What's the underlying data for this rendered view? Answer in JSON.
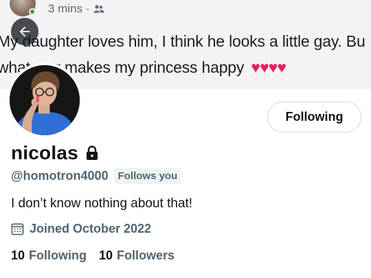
{
  "banner": {
    "post_time": "3 mins",
    "post_separator": "·",
    "audience_icon": "friends-icon",
    "post_line_1": "My daughter loves him, I think he looks a little gay. Bu",
    "post_line_2": "whatever makes my princess happy",
    "hearts": "♥♥♥♥"
  },
  "nav": {
    "back_icon": "arrow-left-icon"
  },
  "profile": {
    "name": "nicolas",
    "protected_icon": "lock-icon",
    "handle": "@homotron4000",
    "follows_you_badge": "Follows you",
    "bio": "I don’t know nothing about that!",
    "joined_icon": "calendar-icon",
    "joined": "Joined October 2022",
    "following_count": "10",
    "following_label": "Following",
    "followers_count": "10",
    "followers_label": "Followers"
  },
  "actions": {
    "follow_button_label": "Following"
  },
  "colors": {
    "text_primary": "#0f1419",
    "text_secondary": "#536471",
    "heart": "#e0245e",
    "online": "#31a24c"
  }
}
